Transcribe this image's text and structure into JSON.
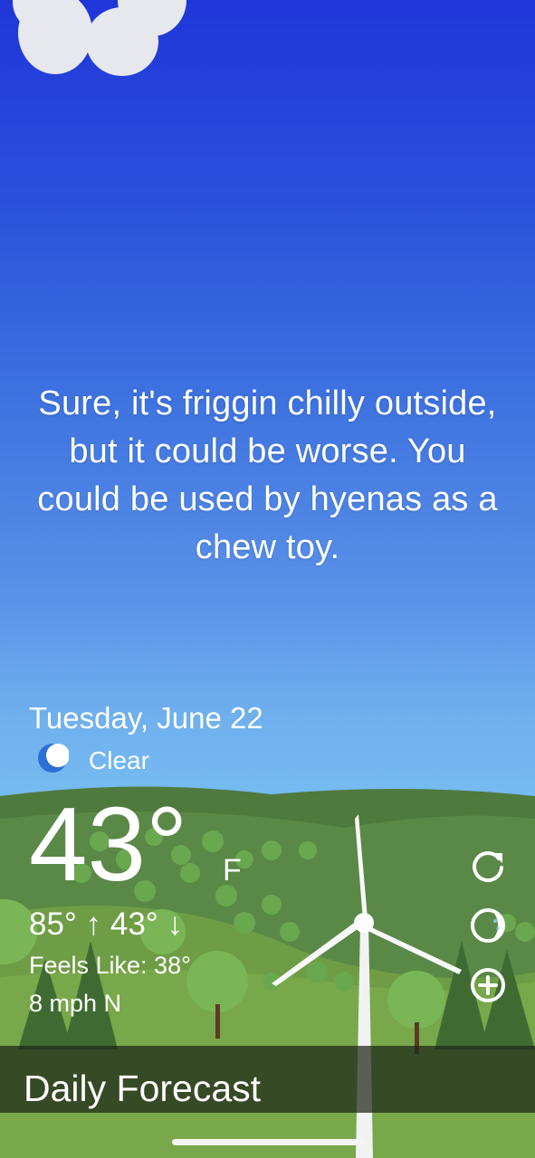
{
  "quote": "Sure, it's friggin chilly outside, but it could be worse. You could be used by hyenas as a chew toy.",
  "current": {
    "date": "Tuesday, June 22",
    "condition": "Clear",
    "condition_icon": "moon-icon",
    "temperature": "43°",
    "unit": "F",
    "high_low": "85° ↑ 43° ↓",
    "feels_like": "Feels Like: 38°",
    "wind": "8 mph N"
  },
  "actions": {
    "refresh_icon": "refresh-icon",
    "theme_icon": "moon-phase-icon",
    "add_icon": "add-location-icon"
  },
  "forecast": {
    "label": "Daily Forecast"
  },
  "colors": {
    "sky_top": "#1f36d9",
    "sky_bottom": "#7fc4f0",
    "hill_far": "#4f7a3e",
    "grass": "#6e9d45",
    "moon": "#2e6fd6"
  }
}
